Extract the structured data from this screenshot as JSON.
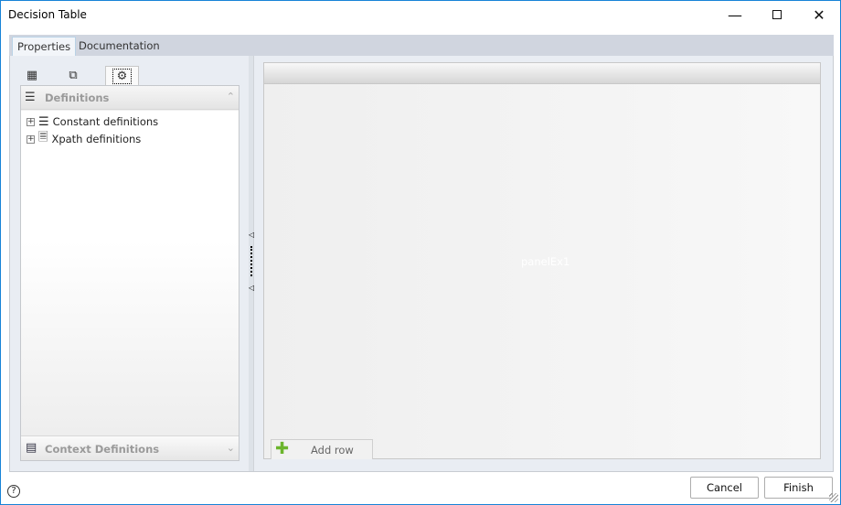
{
  "window": {
    "title": "Decision Table",
    "minimize_icon": "minimize-icon",
    "maximize_icon": "maximize-icon",
    "close_icon": "close-icon",
    "border_color": "#1883d7"
  },
  "tabs": [
    {
      "label": "Properties",
      "active": true
    },
    {
      "label": "Documentation",
      "active": false
    }
  ],
  "left_panel": {
    "icon_tabs": [
      {
        "icon": "document-grid-icon"
      },
      {
        "icon": "nested-boxes-icon"
      },
      {
        "icon": "gear-icon",
        "selected": true
      }
    ],
    "definitions": {
      "title": "Definitions",
      "items": [
        {
          "label": "Constant definitions",
          "icon": "list-icon"
        },
        {
          "label": "Xpath definitions",
          "icon": "xpath-icon"
        }
      ]
    },
    "context_definitions": {
      "title": "Context Definitions"
    }
  },
  "right_panel": {
    "placeholder": "panelEx1",
    "add_row_label": "Add row",
    "add_icon_color": "#6cb52d"
  },
  "footer": {
    "cancel_label": "Cancel",
    "finish_label": "Finish"
  }
}
